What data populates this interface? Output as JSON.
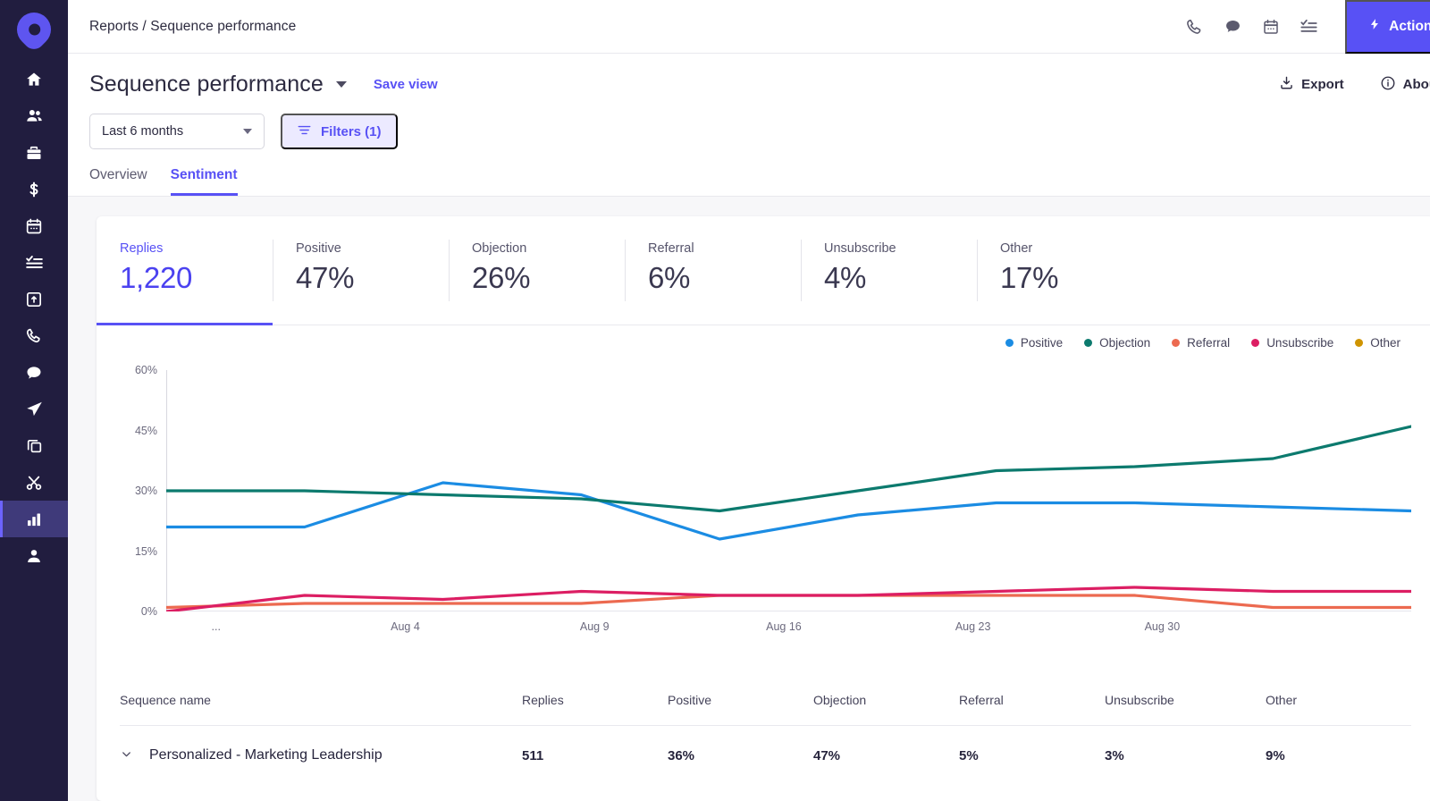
{
  "sidebar": {
    "logo": "outreach-logo",
    "items": [
      {
        "name": "home",
        "icon": "home-icon",
        "active": false
      },
      {
        "name": "people",
        "icon": "people-icon",
        "active": false
      },
      {
        "name": "accounts",
        "icon": "briefcase-icon",
        "active": false
      },
      {
        "name": "opportunities",
        "icon": "dollar-icon",
        "active": false
      },
      {
        "name": "calendar",
        "icon": "calendar-icon",
        "active": false
      },
      {
        "name": "tasks",
        "icon": "task-list-icon",
        "active": false
      },
      {
        "name": "templates",
        "icon": "inbox-add-icon",
        "active": false
      },
      {
        "name": "calls",
        "icon": "phone-icon",
        "active": false
      },
      {
        "name": "messages",
        "icon": "chat-bubble-icon",
        "active": false
      },
      {
        "name": "sequences",
        "icon": "send-icon",
        "active": false
      },
      {
        "name": "snippets",
        "icon": "copy-icon",
        "active": false
      },
      {
        "name": "content",
        "icon": "scissors-icon",
        "active": false
      },
      {
        "name": "reports",
        "icon": "bar-chart-icon",
        "active": true
      },
      {
        "name": "profile",
        "icon": "person-icon",
        "active": false
      }
    ]
  },
  "topbar": {
    "breadcrumb": "Reports / Sequence performance",
    "icons": [
      {
        "name": "phone-icon"
      },
      {
        "name": "chat-bubble-icon"
      },
      {
        "name": "calendar-icon"
      },
      {
        "name": "task-list-icon"
      }
    ],
    "actions_label": "Actions"
  },
  "subheader": {
    "title": "Sequence performance",
    "save_view": "Save view",
    "export_label": "Export",
    "about_label": "About",
    "date_range": "Last 6 months",
    "filters_label": "Filters (1)",
    "tabs": [
      {
        "label": "Overview",
        "active": false
      },
      {
        "label": "Sentiment",
        "active": true
      }
    ]
  },
  "kpis": [
    {
      "label": "Replies",
      "value": "1,220",
      "selected": true
    },
    {
      "label": "Positive",
      "value": "47%",
      "selected": false
    },
    {
      "label": "Objection",
      "value": "26%",
      "selected": false
    },
    {
      "label": "Referral",
      "value": "6%",
      "selected": false
    },
    {
      "label": "Unsubscribe",
      "value": "4%",
      "selected": false
    },
    {
      "label": "Other",
      "value": "17%",
      "selected": false
    }
  ],
  "chart_data": {
    "type": "line",
    "title": "",
    "xlabel": "",
    "ylabel": "",
    "ylim": [
      0,
      60
    ],
    "yticks": [
      "0%",
      "15%",
      "30%",
      "45%",
      "60%"
    ],
    "ytick_values": [
      0,
      15,
      30,
      45,
      60
    ],
    "grid": false,
    "legend_position": "top-right",
    "x": [
      "...",
      "Aug 4",
      "Aug 9",
      "Aug 16",
      "Aug 23",
      "Aug 30",
      ""
    ],
    "xticks": [
      "...",
      "Aug 4",
      "Aug 9",
      "Aug 16",
      "Aug 23",
      "Aug 30"
    ],
    "series": [
      {
        "name": "Positive",
        "color": "#1b8ce3",
        "values": [
          21,
          21,
          32,
          29,
          18,
          24,
          27,
          27,
          26,
          25
        ]
      },
      {
        "name": "Objection",
        "color": "#0c7a6e",
        "values": [
          30,
          30,
          29,
          28,
          25,
          30,
          35,
          36,
          38,
          46
        ]
      },
      {
        "name": "Referral",
        "color": "#ec6a50",
        "values": [
          1,
          2,
          2,
          2,
          4,
          4,
          4,
          4,
          1,
          1
        ]
      },
      {
        "name": "Unsubscribe",
        "color": "#dc1e63",
        "values": [
          0,
          4,
          3,
          5,
          4,
          4,
          5,
          6,
          5,
          5
        ]
      },
      {
        "name": "Other",
        "color": "#cf9400",
        "values": []
      }
    ]
  },
  "table": {
    "columns": [
      "Sequence name",
      "Replies",
      "Positive",
      "Objection",
      "Referral",
      "Unsubscribe",
      "Other"
    ],
    "rows": [
      {
        "name": "Personalized - Marketing Leadership",
        "replies": "511",
        "positive": "36%",
        "objection": "47%",
        "referral": "5%",
        "unsubscribe": "3%",
        "other": "9%"
      }
    ]
  }
}
